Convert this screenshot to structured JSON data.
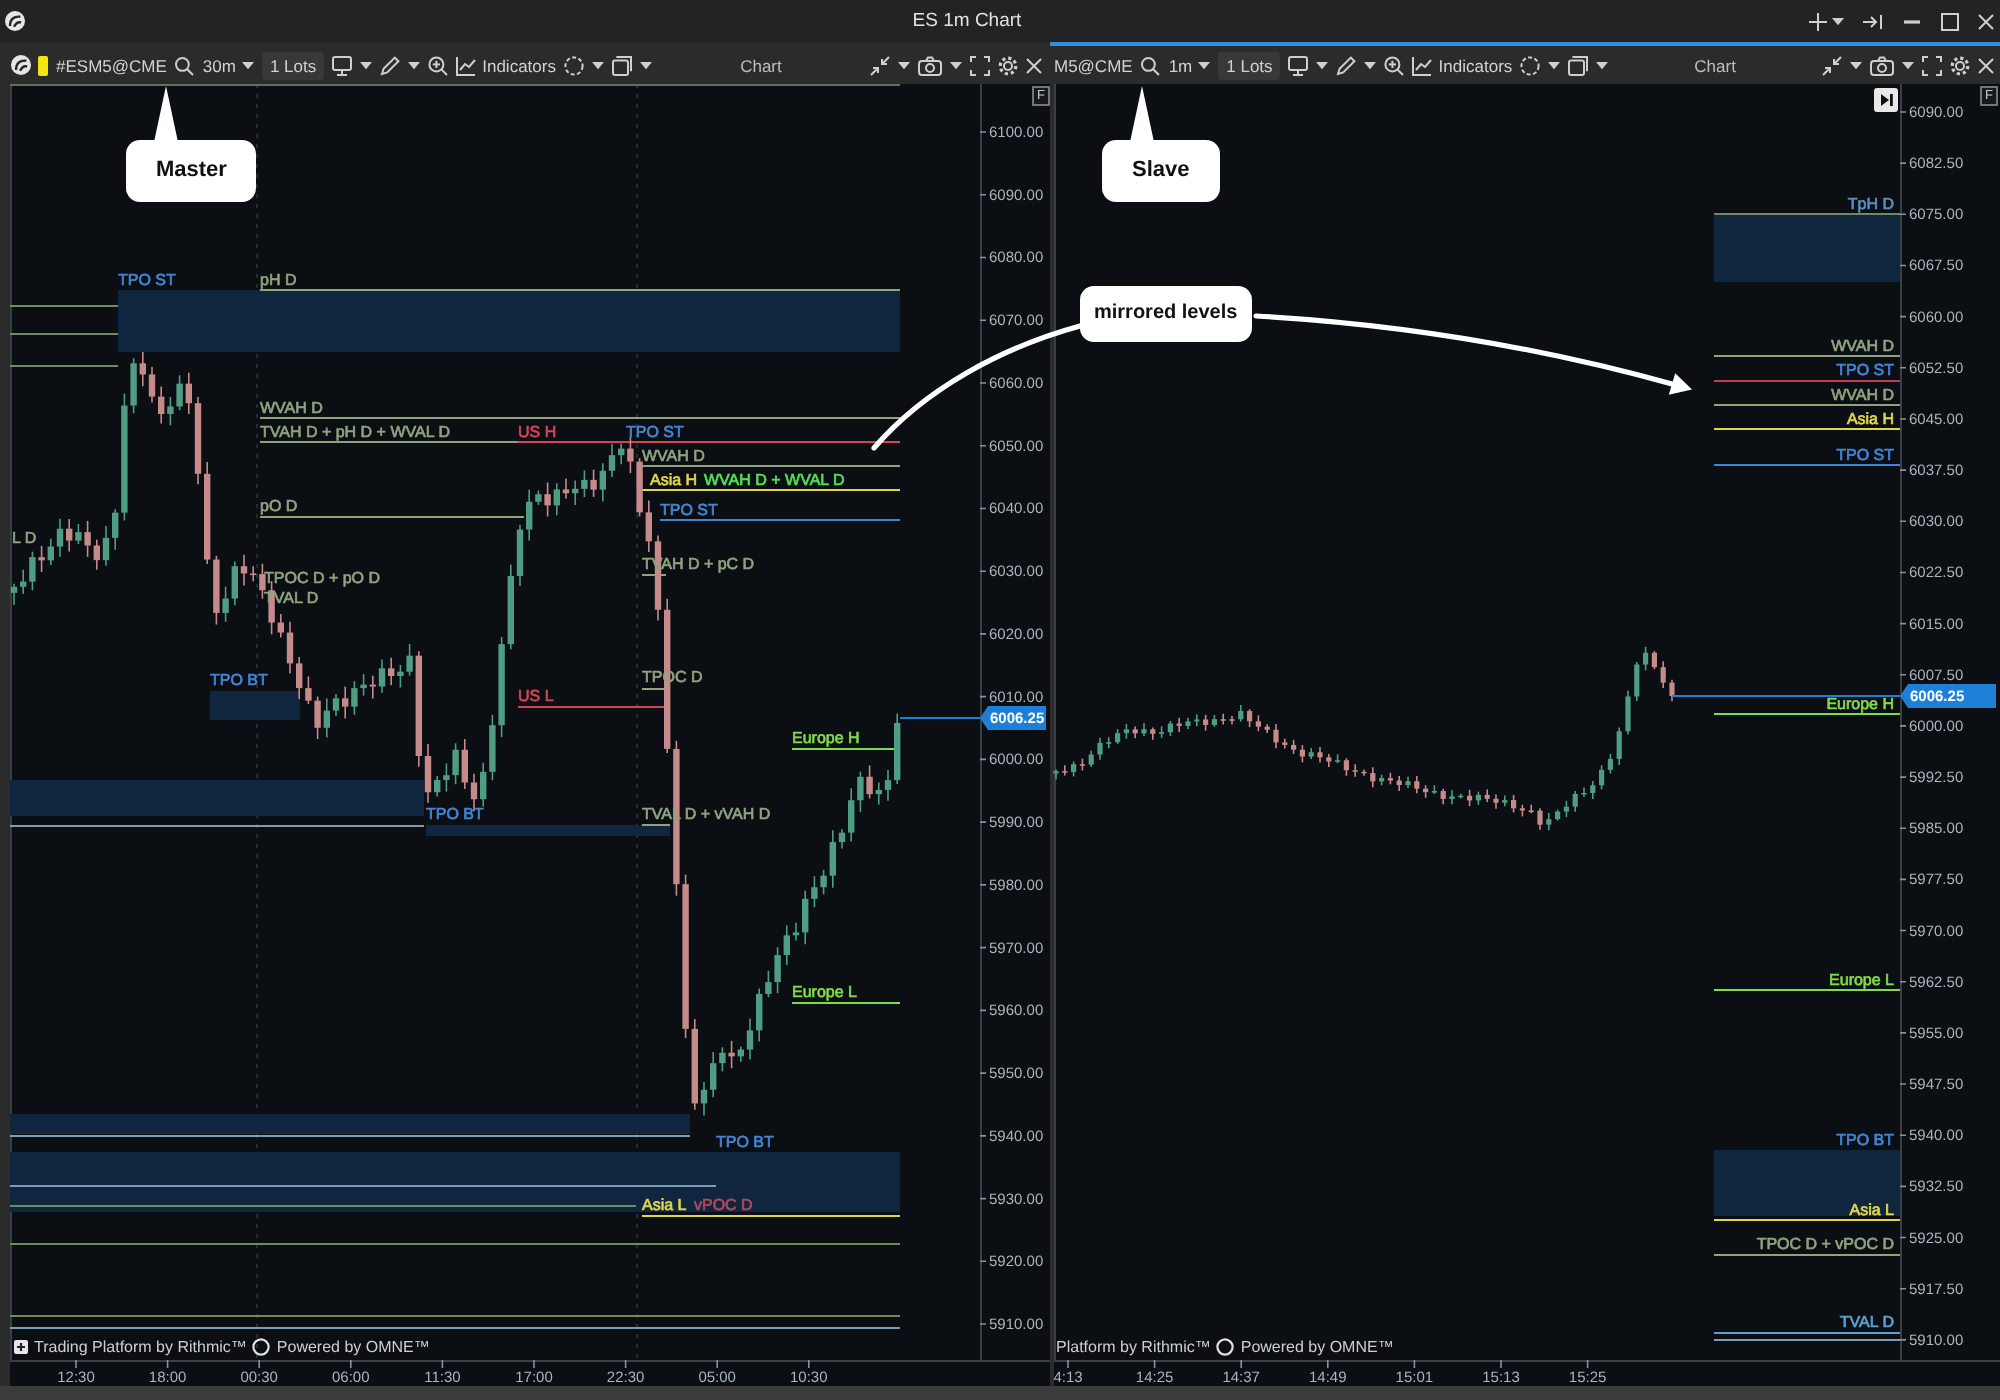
{
  "window": {
    "title": "ES 1m Chart"
  },
  "panes": [
    {
      "selected": false,
      "color": "#f2e40c",
      "symbol": "#ESM5@CME",
      "interval": "30m",
      "lots": "1 Lots",
      "indicators": "Indicators",
      "title": "Chart",
      "scale_button": "F",
      "jump_to_latest": false,
      "callout": "Master",
      "price_axis": [
        "6100.00",
        "6090.00",
        "6080.00",
        "6070.00",
        "6060.00",
        "6050.00",
        "6040.00",
        "6030.00",
        "6020.00",
        "6010.00",
        "6000.00",
        "5990.00",
        "5980.00",
        "5970.00",
        "5960.00",
        "5950.00",
        "5940.00",
        "5930.00",
        "5920.00",
        "5910.00"
      ],
      "current_price": "6006.25",
      "time_axis": [
        "12:30",
        "18:00",
        "00:30",
        "06:00",
        "11:30",
        "17:00",
        "22:30",
        "05:00",
        "10:30"
      ],
      "footer": [
        "Trading Platform by Rithmic™",
        "Powered by OMNE™"
      ],
      "levels": [
        {
          "label": "TPO ST",
          "kind": "zone",
          "color": "#3f86d6"
        },
        {
          "label": "pH D",
          "kind": "line",
          "color": "#8fa37f"
        },
        {
          "label": "WVAH D",
          "kind": "line",
          "color": "#8fa37f"
        },
        {
          "label": "TVAH D + pH D + WVAL D",
          "kind": "line",
          "color": "#8fa37f"
        },
        {
          "label": "US H",
          "kind": "line",
          "color": "#d0455a"
        },
        {
          "label": "TPO ST",
          "kind": "label",
          "color": "#3f86d6"
        },
        {
          "label": "WVAH D",
          "kind": "line",
          "color": "#8fa37f"
        },
        {
          "label": "Asia H",
          "kind": "line",
          "color": "#e0d64a"
        },
        {
          "label": "WVAH D + WVAL D",
          "kind": "label",
          "color": "#52e052"
        },
        {
          "label": "pO D",
          "kind": "line",
          "color": "#8fa37f"
        },
        {
          "label": "TPO ST",
          "kind": "line",
          "color": "#3f86d6"
        },
        {
          "label": "L D",
          "kind": "label",
          "color": "#8fa37f"
        },
        {
          "label": "TVAH D + pC D",
          "kind": "line",
          "color": "#8fa37f"
        },
        {
          "label": "TPOC D + pO D",
          "kind": "label",
          "color": "#8fa37f"
        },
        {
          "label": "TVAL D",
          "kind": "label",
          "color": "#8fa37f"
        },
        {
          "label": "TPO BT",
          "kind": "zone",
          "color": "#3f86d6"
        },
        {
          "label": "TPOC D",
          "kind": "line",
          "color": "#8fa37f"
        },
        {
          "label": "US L",
          "kind": "line",
          "color": "#d0455a"
        },
        {
          "label": "Europe H",
          "kind": "line",
          "color": "#7fdc4a"
        },
        {
          "label": "TPO BT",
          "kind": "zone",
          "color": "#3f86d6"
        },
        {
          "label": "TVAL D + vVAH D",
          "kind": "line",
          "color": "#8fa37f"
        },
        {
          "label": "Europe L",
          "kind": "line",
          "color": "#7fdc4a"
        },
        {
          "label": "TPO BT",
          "kind": "zone",
          "color": "#3f86d6"
        },
        {
          "label": "Asia L",
          "kind": "line",
          "color": "#e0d64a"
        },
        {
          "label": "vPOC D",
          "kind": "label",
          "color": "#b04a5c"
        }
      ]
    },
    {
      "selected": true,
      "symbol": "M5@CME",
      "interval": "1m",
      "lots": "1 Lots",
      "indicators": "Indicators",
      "title": "Chart",
      "scale_button": "F",
      "jump_to_latest": true,
      "callout": "Slave",
      "price_axis": [
        "6090.00",
        "6082.50",
        "6075.00",
        "6067.50",
        "6060.00",
        "6052.50",
        "6045.00",
        "6037.50",
        "6030.00",
        "6022.50",
        "6015.00",
        "6007.50",
        "6000.00",
        "5992.50",
        "5985.00",
        "5977.50",
        "5970.00",
        "5962.50",
        "5955.00",
        "5947.50",
        "5940.00",
        "5932.50",
        "5925.00",
        "5917.50",
        "5910.00"
      ],
      "current_price": "6006.25",
      "time_axis": [
        "4:13",
        "14:25",
        "14:37",
        "14:49",
        "15:01",
        "15:13",
        "15:25"
      ],
      "footer": [
        "Platform by Rithmic™",
        "Powered by OMNE™"
      ],
      "levels": [
        {
          "label": "TpH D",
          "kind": "zone",
          "color": "#5a8fc0"
        },
        {
          "label": "WVAH D",
          "kind": "line",
          "color": "#8fa37f"
        },
        {
          "label": "TPO ST",
          "kind": "label",
          "color": "#3f86d6"
        },
        {
          "label": "WVAH D",
          "kind": "line",
          "color": "#8fa37f"
        },
        {
          "label": "Asia H",
          "kind": "line",
          "color": "#e0d64a"
        },
        {
          "label": "TPO ST",
          "kind": "line",
          "color": "#3f86d6"
        },
        {
          "label": "Europe H",
          "kind": "line",
          "color": "#7fdc4a"
        },
        {
          "label": "Europe L",
          "kind": "line",
          "color": "#7fdc4a"
        },
        {
          "label": "TPO BT",
          "kind": "zone",
          "color": "#3f86d6"
        },
        {
          "label": "Asia L",
          "kind": "line",
          "color": "#e0d64a"
        },
        {
          "label": "TPOC D + vPOC D",
          "kind": "line",
          "color": "#8fa37f"
        },
        {
          "label": "TVAL D",
          "kind": "line",
          "color": "#5aa0d0"
        }
      ]
    }
  ],
  "annotation": {
    "text": "mirrored levels"
  }
}
